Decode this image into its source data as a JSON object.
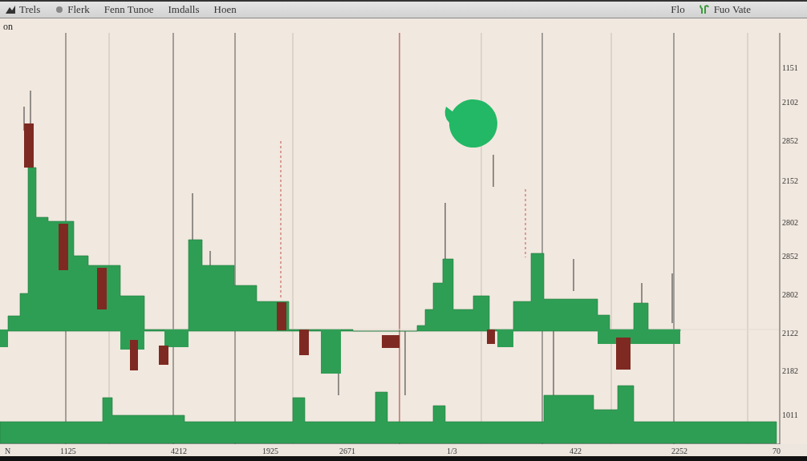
{
  "toolbar": {
    "items": [
      {
        "label": "Trels"
      },
      {
        "label": "Flerk"
      },
      {
        "label": "Fenn Tunoe"
      },
      {
        "label": "Imdalls"
      },
      {
        "label": "Hoen"
      }
    ],
    "right_items": [
      {
        "label": "Flo"
      },
      {
        "label": "Fuo Vate"
      }
    ]
  },
  "chart_header": {
    "title": "on"
  },
  "y_axis_labels": [
    "1151",
    "2102",
    "2852",
    "2152",
    "2802",
    "2852",
    "2802",
    "2122",
    "2182",
    "1011"
  ],
  "x_axis_labels": [
    "N",
    "1125",
    "4212",
    "1925",
    "2671",
    "1/3",
    "422",
    "2252",
    "70"
  ]
}
